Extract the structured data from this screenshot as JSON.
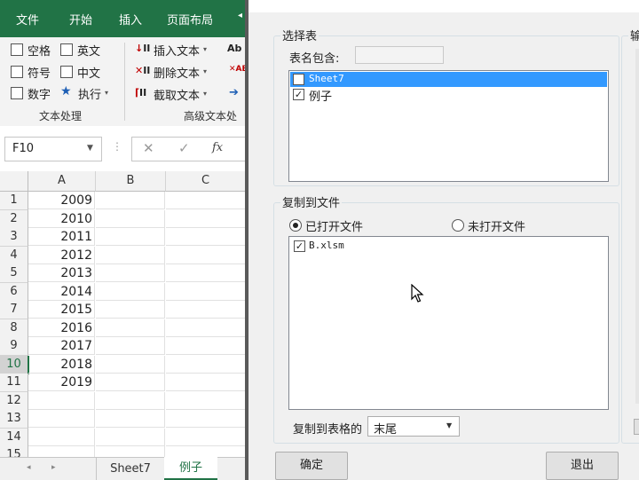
{
  "excel": {
    "ribbon_tabs": [
      "文件",
      "开始",
      "插入",
      "页面布局"
    ],
    "checkboxes": [
      {
        "label": "空格"
      },
      {
        "label": "英文"
      },
      {
        "label": "符号"
      },
      {
        "label": "中文"
      },
      {
        "label": "数字"
      }
    ],
    "execute_label": "执行",
    "group_text_processing": "文本处理",
    "commands": [
      "插入文本",
      "删除文本",
      "截取文本"
    ],
    "group_advanced": "高级文本处",
    "name_box": "F10",
    "fx_label": "fx",
    "columns": [
      "A",
      "B",
      "C"
    ],
    "rows": [
      {
        "num": "1",
        "a": "2009"
      },
      {
        "num": "2",
        "a": "2010"
      },
      {
        "num": "3",
        "a": "2011"
      },
      {
        "num": "4",
        "a": "2012"
      },
      {
        "num": "5",
        "a": "2013"
      },
      {
        "num": "6",
        "a": "2014"
      },
      {
        "num": "7",
        "a": "2015"
      },
      {
        "num": "8",
        "a": "2016"
      },
      {
        "num": "9",
        "a": "2017"
      },
      {
        "num": "10",
        "a": "2018"
      },
      {
        "num": "11",
        "a": "2019"
      },
      {
        "num": "12",
        "a": ""
      },
      {
        "num": "13",
        "a": ""
      },
      {
        "num": "14",
        "a": ""
      },
      {
        "num": "15",
        "a": ""
      }
    ],
    "sheet_tabs": [
      "Sheet7",
      "例子"
    ],
    "active_sheet": "例子"
  },
  "dialog": {
    "select_table_group": "选择表",
    "table_name_contains": "表名包含:",
    "table_filter_value": "",
    "sheets": [
      {
        "name": "Sheet7",
        "checked": false,
        "selected": true
      },
      {
        "name": "例子",
        "checked": true,
        "selected": false
      }
    ],
    "copy_to_file_group": "复制到文件",
    "radio_open": "已打开文件",
    "radio_unopened": "未打开文件",
    "files": [
      {
        "name": "B.xlsm",
        "checked": true
      }
    ],
    "copy_to_position_label": "复制到表格的",
    "copy_to_position_value": "末尾",
    "ok_button": "确定",
    "exit_button": "退出",
    "right_group_partial": "输"
  },
  "colors": {
    "excel_green": "#217346",
    "selection_blue": "#3399ff"
  }
}
